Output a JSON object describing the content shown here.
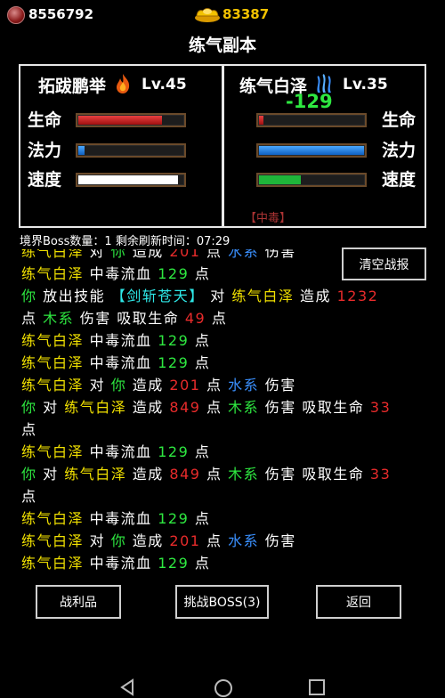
{
  "header": {
    "gems": "8556792",
    "gold": "83387",
    "title": "练气副本"
  },
  "player": {
    "name": "拓跋鹏举",
    "level": "Lv.45",
    "labels": {
      "hp": "生命",
      "mp": "法力",
      "speed": "速度"
    },
    "hp_pct": 80,
    "mp_pct": 6,
    "speed_pct": 95
  },
  "enemy": {
    "name": "练气白泽",
    "level": "Lv.35",
    "damage": "-129",
    "status": "【中毒】",
    "labels": {
      "hp": "生命",
      "mp": "法力",
      "speed": "速度"
    },
    "hp_pct": 4,
    "mp_pct": 100,
    "speed_pct": 40
  },
  "info": "境界Boss数量：1 剩余刷新时间：07:29",
  "buttons": {
    "clear_log": "清空战报",
    "loot": "战利品",
    "challenge": "挑战BOSS(3)",
    "back": "返回"
  },
  "colors": {
    "enemy_name": "#f0e000",
    "player_name": "#2ee840",
    "damage_number": "#e82b2b",
    "water_element": "#3a90ff",
    "wood_element": "#2ee840",
    "skill": "#2ee8e8"
  },
  "log": [
    [
      {
        "t": "练气白泽",
        "c": "y"
      },
      {
        "t": " 对 ",
        "c": "w"
      },
      {
        "t": "你",
        "c": "g"
      },
      {
        "t": " 造成 ",
        "c": "w"
      },
      {
        "t": "201",
        "c": "r"
      },
      {
        "t": " 点 ",
        "c": "w"
      },
      {
        "t": "水系",
        "c": "b"
      },
      {
        "t": " 伤害",
        "c": "w"
      }
    ],
    [
      {
        "t": "练气白泽",
        "c": "y"
      },
      {
        "t": " 中毒流血 ",
        "c": "w"
      },
      {
        "t": "129",
        "c": "g"
      },
      {
        "t": " 点",
        "c": "w"
      }
    ],
    [
      {
        "t": "你",
        "c": "g"
      },
      {
        "t": " 放出技能 ",
        "c": "w"
      },
      {
        "t": "【剑斩苍天】",
        "c": "c"
      },
      {
        "t": " 对 ",
        "c": "w"
      },
      {
        "t": "练气白泽",
        "c": "y"
      },
      {
        "t": " 造成 ",
        "c": "w"
      },
      {
        "t": "1232",
        "c": "r"
      }
    ],
    [
      {
        "t": "点 ",
        "c": "w"
      },
      {
        "t": "木系",
        "c": "g"
      },
      {
        "t": " 伤害 吸取生命 ",
        "c": "w"
      },
      {
        "t": "49",
        "c": "r"
      },
      {
        "t": " 点",
        "c": "w"
      }
    ],
    [
      {
        "t": "练气白泽",
        "c": "y"
      },
      {
        "t": " 中毒流血 ",
        "c": "w"
      },
      {
        "t": "129",
        "c": "g"
      },
      {
        "t": " 点",
        "c": "w"
      }
    ],
    [
      {
        "t": "练气白泽",
        "c": "y"
      },
      {
        "t": " 中毒流血 ",
        "c": "w"
      },
      {
        "t": "129",
        "c": "g"
      },
      {
        "t": " 点",
        "c": "w"
      }
    ],
    [
      {
        "t": "练气白泽",
        "c": "y"
      },
      {
        "t": " 对 ",
        "c": "w"
      },
      {
        "t": "你",
        "c": "g"
      },
      {
        "t": " 造成 ",
        "c": "w"
      },
      {
        "t": "201",
        "c": "r"
      },
      {
        "t": " 点 ",
        "c": "w"
      },
      {
        "t": "水系",
        "c": "b"
      },
      {
        "t": " 伤害",
        "c": "w"
      }
    ],
    [
      {
        "t": "你",
        "c": "g"
      },
      {
        "t": " 对 ",
        "c": "w"
      },
      {
        "t": "练气白泽",
        "c": "y"
      },
      {
        "t": " 造成 ",
        "c": "w"
      },
      {
        "t": "849",
        "c": "r"
      },
      {
        "t": " 点 ",
        "c": "w"
      },
      {
        "t": "木系",
        "c": "g"
      },
      {
        "t": " 伤害 吸取生命 ",
        "c": "w"
      },
      {
        "t": "33",
        "c": "r"
      }
    ],
    [
      {
        "t": "点",
        "c": "w"
      }
    ],
    [
      {
        "t": "练气白泽",
        "c": "y"
      },
      {
        "t": " 中毒流血 ",
        "c": "w"
      },
      {
        "t": "129",
        "c": "g"
      },
      {
        "t": " 点",
        "c": "w"
      }
    ],
    [
      {
        "t": "你",
        "c": "g"
      },
      {
        "t": " 对 ",
        "c": "w"
      },
      {
        "t": "练气白泽",
        "c": "y"
      },
      {
        "t": " 造成 ",
        "c": "w"
      },
      {
        "t": "849",
        "c": "r"
      },
      {
        "t": " 点 ",
        "c": "w"
      },
      {
        "t": "木系",
        "c": "g"
      },
      {
        "t": " 伤害 吸取生命 ",
        "c": "w"
      },
      {
        "t": "33",
        "c": "r"
      }
    ],
    [
      {
        "t": "点",
        "c": "w"
      }
    ],
    [
      {
        "t": "练气白泽",
        "c": "y"
      },
      {
        "t": " 中毒流血 ",
        "c": "w"
      },
      {
        "t": "129",
        "c": "g"
      },
      {
        "t": " 点",
        "c": "w"
      }
    ],
    [
      {
        "t": "练气白泽",
        "c": "y"
      },
      {
        "t": " 对 ",
        "c": "w"
      },
      {
        "t": "你",
        "c": "g"
      },
      {
        "t": " 造成 ",
        "c": "w"
      },
      {
        "t": "201",
        "c": "r"
      },
      {
        "t": " 点 ",
        "c": "w"
      },
      {
        "t": "水系",
        "c": "b"
      },
      {
        "t": " 伤害",
        "c": "w"
      }
    ],
    [
      {
        "t": "练气白泽",
        "c": "y"
      },
      {
        "t": " 中毒流血 ",
        "c": "w"
      },
      {
        "t": "129",
        "c": "g"
      },
      {
        "t": " 点",
        "c": "w"
      }
    ]
  ]
}
